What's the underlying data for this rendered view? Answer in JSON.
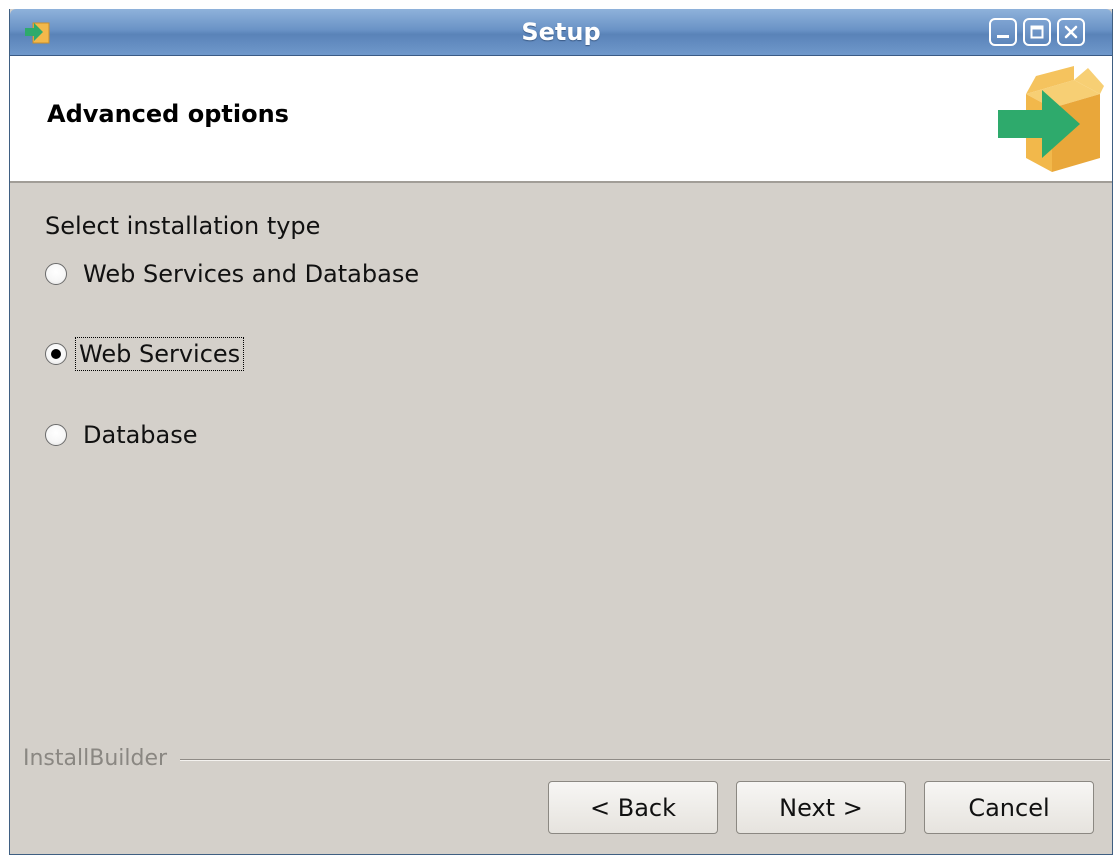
{
  "window": {
    "title": "Setup",
    "title_icon": "installer-arrow-icon",
    "controls": [
      "minimize-icon",
      "maximize-icon",
      "close-icon"
    ]
  },
  "banner": {
    "title": "Advanced options",
    "logo": "box-arrow-logo"
  },
  "content": {
    "prompt": "Select installation type",
    "options": [
      {
        "label": "Web Services and Database",
        "selected": false
      },
      {
        "label": "Web Services",
        "selected": true
      },
      {
        "label": "Database",
        "selected": false
      }
    ]
  },
  "footer": {
    "brand": "InstallBuilder",
    "back_label": "< Back",
    "next_label": "Next >",
    "cancel_label": "Cancel"
  },
  "colors": {
    "window_background": "#d4d0ca",
    "titlebar": "#6a93c6",
    "logo_box": "#f2b84b",
    "logo_arrow": "#2eaa6c"
  }
}
